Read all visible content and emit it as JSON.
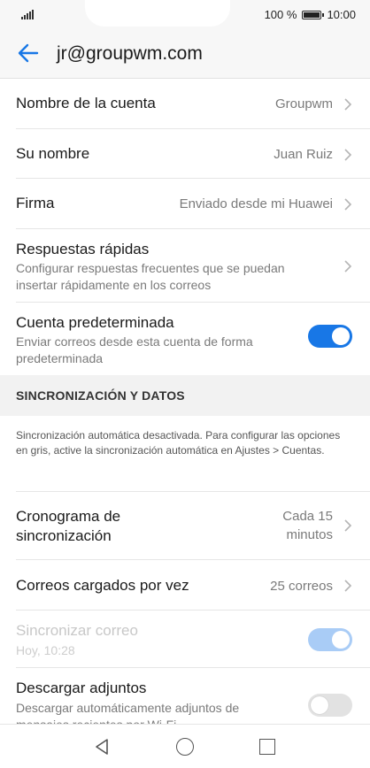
{
  "status_bar": {
    "battery_percent": "100 %",
    "time": "10:00"
  },
  "app_bar": {
    "title": "jr@groupwm.com"
  },
  "account_settings": [
    {
      "label": "Nombre de la cuenta",
      "value": "Groupwm"
    },
    {
      "label": "Su nombre",
      "value": "Juan Ruiz"
    },
    {
      "label": "Firma",
      "value": "Enviado desde mi Huawei"
    },
    {
      "label": "Respuestas rápidas",
      "sub": "Configurar respuestas frecuentes que se puedan insertar rápidamente en los correos"
    },
    {
      "label": "Cuenta predeterminada",
      "sub": "Enviar correos desde esta cuenta de forma predeterminada",
      "toggle": "on"
    }
  ],
  "sync_section": {
    "header": "SINCRONIZACIÓN Y DATOS",
    "note": "Sincronización automática desactivada. Para configurar las opciones en gris, active la sincronización automática en Ajustes > Cuentas.",
    "schedule": {
      "label": "Cronograma de sincronización",
      "value": "Cada 15 minutos"
    },
    "emails_per_load": {
      "label": "Correos cargados por vez",
      "value": "25 correos"
    },
    "sync_mail": {
      "label": "Sincronizar correo",
      "sub": "Hoy, 10:28",
      "toggle": "on",
      "enabled": false
    },
    "download_attachments": {
      "label": "Descargar adjuntos",
      "sub": "Descargar automáticamente adjuntos de mensajes recientes por Wi-Fi",
      "toggle": "off"
    }
  },
  "icons": {
    "back": "arrow-left-icon",
    "chevron": "chevron-right-icon",
    "signal": "signal-icon",
    "battery": "battery-icon",
    "nav_back": "triangle-back-icon",
    "nav_home": "circle-home-icon",
    "nav_recent": "square-recent-icon"
  },
  "colors": {
    "accent": "#1877e6",
    "accent_disabled": "#a9ccf6",
    "toggle_off": "#e2e2e2"
  }
}
